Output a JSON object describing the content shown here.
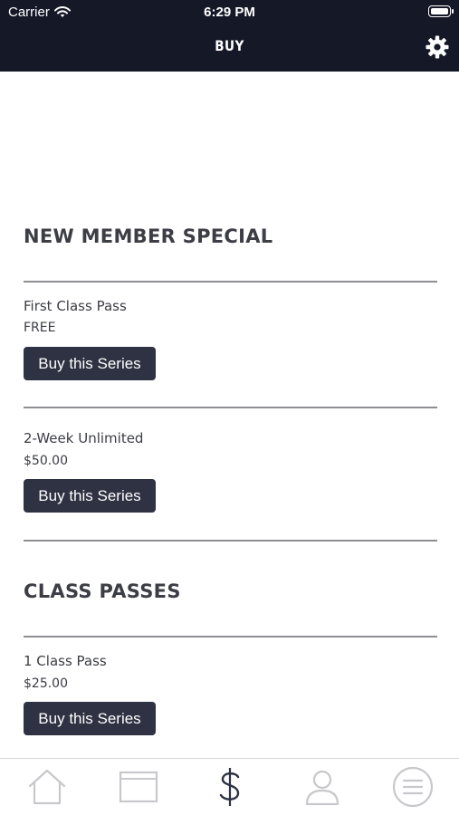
{
  "status_bar": {
    "carrier": "Carrier",
    "time": "6:29 PM"
  },
  "header": {
    "title": "BUY",
    "settings_icon": "gear-icon"
  },
  "sections": [
    {
      "title": "NEW MEMBER SPECIAL",
      "items": [
        {
          "name": "First Class Pass",
          "price": "FREE",
          "button": "Buy this Series"
        },
        {
          "name": "2-Week Unlimited",
          "price": "$50.00",
          "button": "Buy this Series"
        }
      ]
    },
    {
      "title": "CLASS PASSES",
      "items": [
        {
          "name": "1 Class Pass",
          "price": "$25.00",
          "button": "Buy this Series"
        }
      ]
    }
  ],
  "tabbar": {
    "tabs": [
      {
        "icon": "home-icon",
        "active": false
      },
      {
        "icon": "schedule-icon",
        "active": false
      },
      {
        "icon": "dollar-icon",
        "active": true
      },
      {
        "icon": "profile-icon",
        "active": false
      },
      {
        "icon": "menu-icon",
        "active": false
      }
    ]
  },
  "colors": {
    "header_bg": "#151827",
    "button_bg": "#2e3242",
    "text": "#3c3d45",
    "divider": "#8e8e92",
    "tab_inactive": "#c8c8cc",
    "tab_active": "#2e3242"
  }
}
